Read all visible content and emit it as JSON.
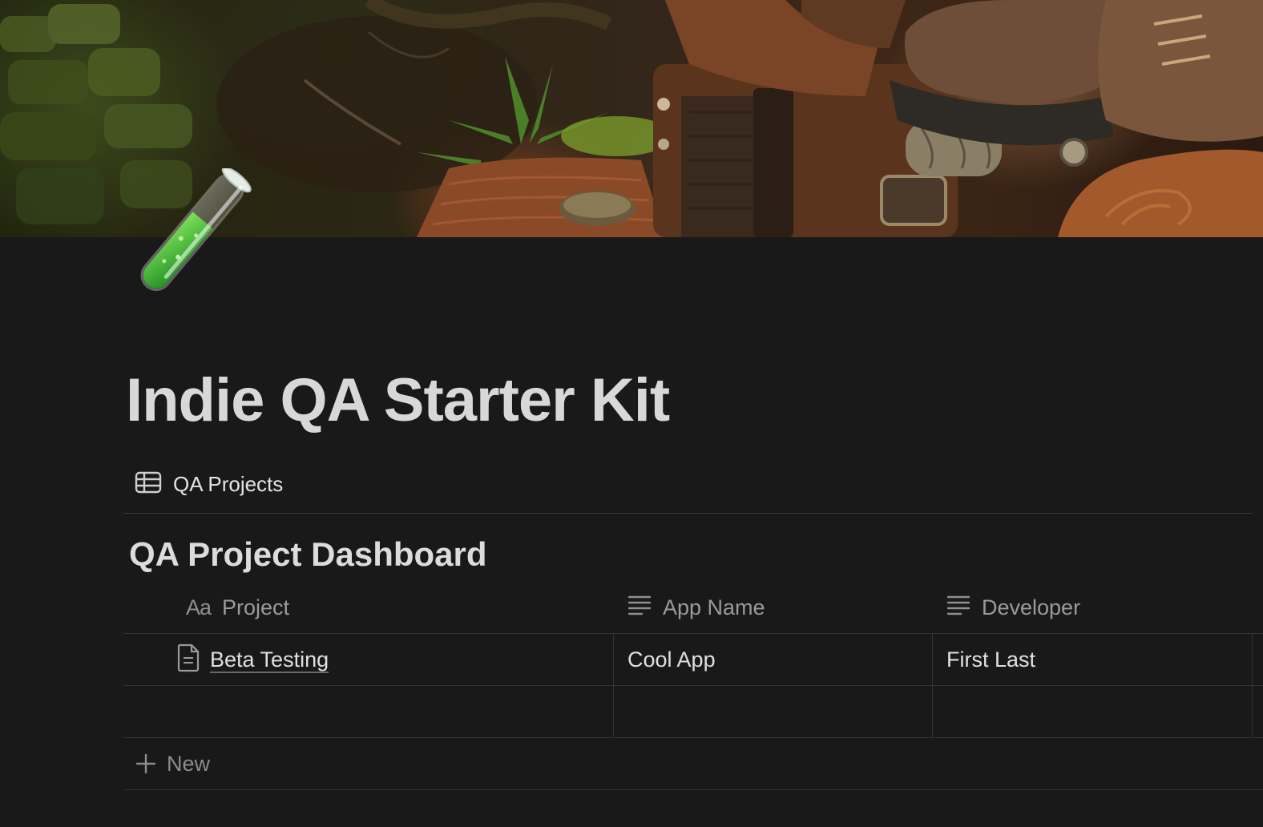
{
  "page": {
    "title": "Indie QA Starter Kit",
    "icon": "test-tube-icon",
    "cover": "adventure-gear-cover-image"
  },
  "database": {
    "tab_label": "QA Projects",
    "tab_icon": "table-icon",
    "title": "QA Project Dashboard",
    "columns": [
      {
        "label": "Project",
        "icon": "title-property-icon",
        "icon_text": "Aa"
      },
      {
        "label": "App Name",
        "icon": "text-property-icon"
      },
      {
        "label": "Developer",
        "icon": "text-property-icon"
      }
    ],
    "rows": [
      {
        "project": "Beta Testing",
        "app_name": "Cool App",
        "developer": "First Last"
      }
    ],
    "new_label": "New"
  },
  "colors": {
    "background": "#191919",
    "text": "#d4d4d4",
    "muted": "#9b9b9b",
    "border": "#333333"
  }
}
